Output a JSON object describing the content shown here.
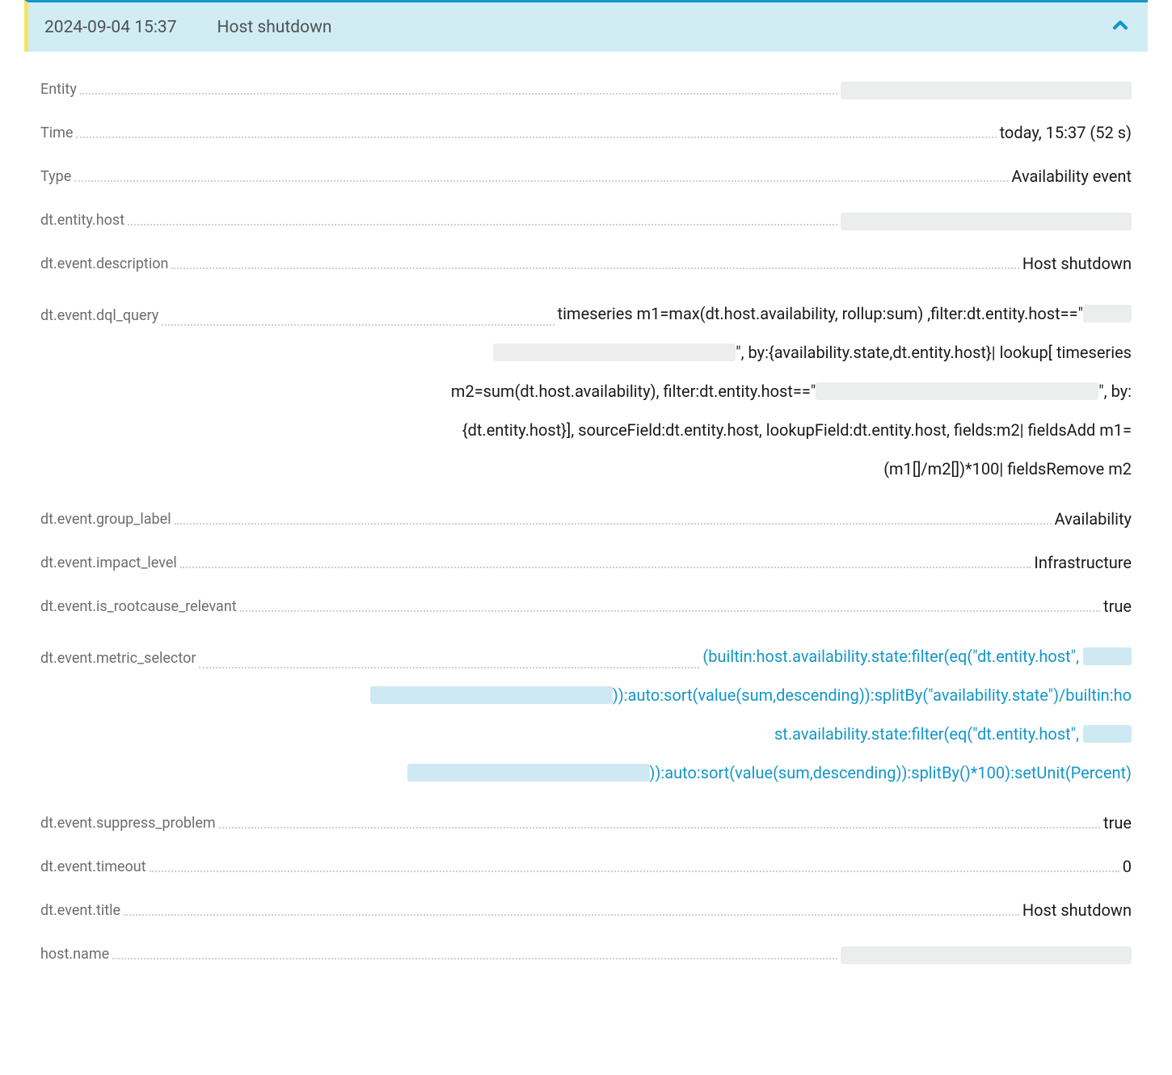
{
  "header": {
    "timestamp": "2024-09-04 15:37",
    "title": "Host shutdown"
  },
  "rows": {
    "entity_label": "Entity",
    "time_label": "Time",
    "time_value": "today, 15:37 (52 s)",
    "type_label": "Type",
    "type_value": "Availability event",
    "dt_entity_host_label": "dt.entity.host",
    "dt_event_description_label": "dt.event.description",
    "dt_event_description_value": "Host shutdown",
    "dt_event_dql_query_label": "dt.event.dql_query",
    "dql_part1": "timeseries m1=max(dt.host.availability, rollup:sum) ,filter:dt.entity.host==\"",
    "dql_part2": "\", by:{availability.state,dt.entity.host}| lookup[ timeseries",
    "dql_part3": "m2=sum(dt.host.availability), filter:dt.entity.host==\"",
    "dql_part4": "\", by:",
    "dql_part5": "{dt.entity.host}], sourceField:dt.entity.host, lookupField:dt.entity.host, fields:m2| fieldsAdd m1=",
    "dql_part6": "(m1[]/m2[])*100| fieldsRemove m2",
    "dt_event_group_label_label": "dt.event.group_label",
    "dt_event_group_label_value": "Availability",
    "dt_event_impact_level_label": "dt.event.impact_level",
    "dt_event_impact_level_value": "Infrastructure",
    "dt_event_is_rootcause_relevant_label": "dt.event.is_rootcause_relevant",
    "dt_event_is_rootcause_relevant_value": "true",
    "dt_event_metric_selector_label": "dt.event.metric_selector",
    "metric_part1": "(builtin:host.availability.state:filter(eq(\"dt.entity.host\",",
    "metric_part2": ")):auto:sort(value(sum,descending)):splitBy(\"availability.state\")/builtin:ho",
    "metric_part3": "st.availability.state:filter(eq(\"dt.entity.host\",",
    "metric_part4": ")):auto:sort(value(sum,descending)):splitBy()*100):setUnit(Percent)",
    "dt_event_suppress_problem_label": "dt.event.suppress_problem",
    "dt_event_suppress_problem_value": "true",
    "dt_event_timeout_label": "dt.event.timeout",
    "dt_event_timeout_value": "0",
    "dt_event_title_label": "dt.event.title",
    "dt_event_title_value": "Host shutdown",
    "host_name_label": "host.name"
  }
}
